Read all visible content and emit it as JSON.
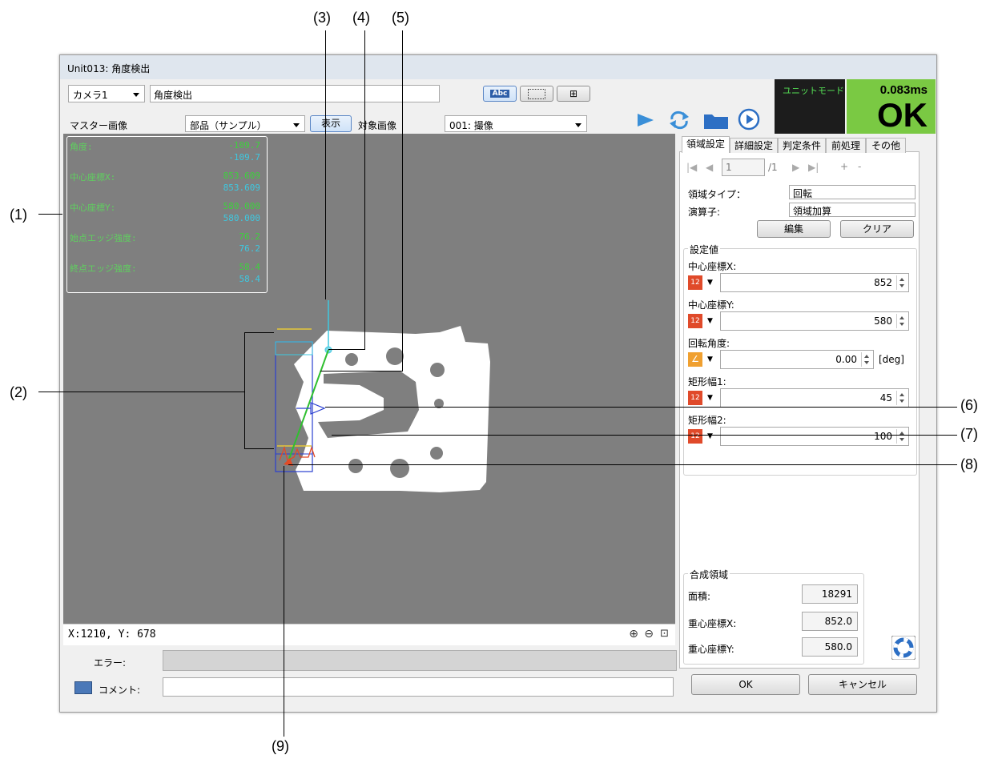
{
  "callouts": {
    "c1": "(1)",
    "c2": "(2)",
    "c3": "(3)",
    "c4": "(4)",
    "c5": "(5)",
    "c6": "(6)",
    "c7": "(7)",
    "c8": "(8)",
    "c9": "(9)"
  },
  "window": {
    "title": "Unit013: 角度検出"
  },
  "toolbar": {
    "camera_select": "カメラ1",
    "unit_name": "角度検出",
    "abc_icon": "Abc",
    "master_label": "マスター画像",
    "master_select": "部品（サンプル）",
    "show_button": "表示",
    "target_label": "対象画像",
    "target_select": "001: 撮像"
  },
  "status": {
    "mode_label": "ユニットモード",
    "time": "0.083ms",
    "result": "OK",
    "result_color": "#7ac943",
    "mode_bg": "#1c1c1c"
  },
  "icons": [
    "play-icon",
    "repeat-icon",
    "folder-icon",
    "circle-play-icon",
    "zoom-in-icon",
    "zoom-out-icon",
    "fit-icon",
    "help-lifebuoy-icon",
    "keyboard-icon"
  ],
  "overlay": {
    "angle_label": "角度:",
    "angle_val1": "-109.7",
    "angle_val2": "-109.7",
    "cx_label": "中心座標X:",
    "cx_val1": "853.609",
    "cx_val2": "853.609",
    "cy_label": "中心座標Y:",
    "cy_val1": "580.000",
    "cy_val2": "580.000",
    "start_label": "始点エッジ強度:",
    "start_val1": "76.2",
    "start_val2": "76.2",
    "end_label": "終点エッジ強度:",
    "end_val1": "58.4",
    "end_val2": "58.4"
  },
  "coord_readout": "X:1210, Y: 678",
  "footer": {
    "error_label": "エラー:",
    "comment_label": "コメント:",
    "ok_button": "OK",
    "cancel_button": "キャンセル"
  },
  "panel": {
    "tabs": [
      "領域設定",
      "詳細設定",
      "判定条件",
      "前処理",
      "その他"
    ],
    "nav_page": "1",
    "nav_total": "/1",
    "nav_plus": "+",
    "nav_minus": "-",
    "region_type_label": "領域タイプ：",
    "region_type_value": "回転",
    "operator_label": "演算子:",
    "operator_value": "領域加算",
    "edit_button": "編集",
    "clear_button": "クリア",
    "settings_group": "設定値",
    "cx_label": "中心座標X:",
    "cx_value": "852",
    "cy_label": "中心座標Y:",
    "cy_value": "580",
    "rot_label": "回転角度:",
    "rot_value": "0.00",
    "rot_unit": "[deg]",
    "w1_label": "矩形幅1:",
    "w1_value": "45",
    "w2_label": "矩形幅2:",
    "w2_value": "100",
    "composite_group": "合成領域",
    "area_label": "面積:",
    "area_value": "18291",
    "gx_label": "重心座標X:",
    "gx_value": "852.0",
    "gy_label": "重心座標Y:",
    "gy_value": "580.0"
  }
}
